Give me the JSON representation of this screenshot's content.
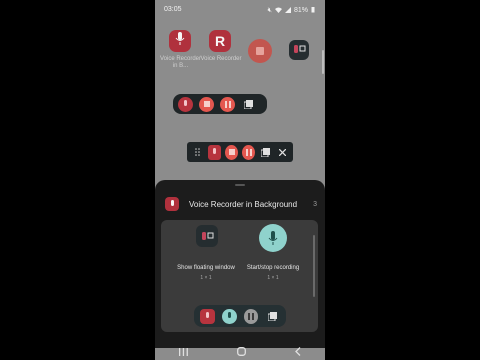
{
  "status_bar": {
    "time": "03:05",
    "battery": "81%"
  },
  "home": {
    "apps": [
      {
        "label": "Voice Recorder in B..."
      },
      {
        "label": "Voice Recorder",
        "glyph": "R"
      }
    ]
  },
  "widget_picker": {
    "title": "Voice Recorder in Background",
    "count": "3",
    "widgets": [
      {
        "label": "Show floating window",
        "size": "1 × 1"
      },
      {
        "label": "Start/stop recording",
        "size": "1 × 1"
      }
    ]
  },
  "colors": {
    "accent_red": "#b0313d",
    "teal": "#8fd2cc",
    "stop_red": "#e4574f",
    "bar_bg": "#1f2527"
  },
  "icons": [
    "mic-icon",
    "stop-icon",
    "pause-icon",
    "copy-icon",
    "drag-icon",
    "close-icon",
    "recents-icon",
    "home-icon",
    "back-icon"
  ]
}
